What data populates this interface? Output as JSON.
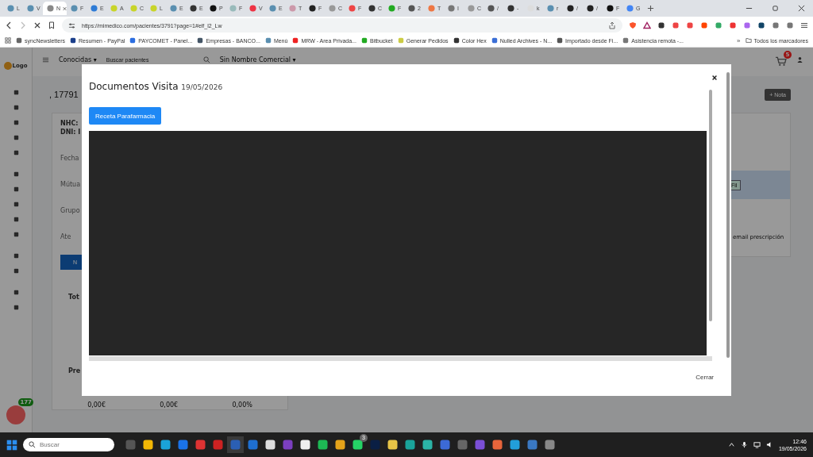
{
  "browser": {
    "tabs": [
      {
        "label": "L",
        "selected": false
      },
      {
        "label": "V",
        "selected": false
      },
      {
        "label": "N",
        "selected": true
      },
      {
        "label": "F",
        "selected": false
      },
      {
        "label": "E",
        "selected": false
      },
      {
        "label": "A",
        "selected": false
      },
      {
        "label": "C",
        "selected": false
      },
      {
        "label": "L",
        "selected": false
      },
      {
        "label": "E",
        "selected": false
      },
      {
        "label": "E",
        "selected": false
      },
      {
        "label": "P",
        "selected": false
      },
      {
        "label": "F",
        "selected": false
      },
      {
        "label": "V",
        "selected": false
      },
      {
        "label": "E",
        "selected": false
      },
      {
        "label": "T",
        "selected": false
      },
      {
        "label": "F",
        "selected": false
      },
      {
        "label": "C",
        "selected": false
      },
      {
        "label": "F",
        "selected": false
      },
      {
        "label": "C",
        "selected": false
      },
      {
        "label": "F",
        "selected": false
      },
      {
        "label": "2",
        "selected": false
      },
      {
        "label": "T",
        "selected": false
      },
      {
        "label": "I",
        "selected": false
      },
      {
        "label": "C",
        "selected": false
      },
      {
        "label": "/",
        "selected": false
      },
      {
        "label": "-",
        "selected": false
      },
      {
        "label": "k",
        "selected": false
      },
      {
        "label": "r",
        "selected": false
      },
      {
        "label": "/",
        "selected": false
      },
      {
        "label": "/",
        "selected": false
      },
      {
        "label": "F",
        "selected": false
      },
      {
        "label": "G",
        "selected": false
      }
    ],
    "url": "https://mimedico.com/pacientes/3791?page=1#elf_l2_Lw",
    "bookmarks": [
      {
        "label": "syncNewsletters"
      },
      {
        "label": "Resumen - PayPal"
      },
      {
        "label": "PAYCOMET - Panel..."
      },
      {
        "label": "Empresas - BANCO..."
      },
      {
        "label": "Menú"
      },
      {
        "label": "MRW - Area Privada..."
      },
      {
        "label": "Bitbucket"
      },
      {
        "label": "Generar Pedidos"
      },
      {
        "label": "Color Hex"
      },
      {
        "label": "Nulled Archives - N..."
      },
      {
        "label": "Importado desde Fi..."
      },
      {
        "label": "Asistencia remota -..."
      }
    ],
    "more_bookmarks": "»",
    "all_bookmarks": "Todos los marcadores"
  },
  "page": {
    "logo": "Logo",
    "nav": {
      "menu": "Conocidas ▾",
      "search_placeholder": "Buscar pacientes",
      "company": "Sin Nombre Comercial ▾"
    },
    "cart_badge": "5",
    "patient_title": ", 17791",
    "info_lines": [
      "NHC:",
      "DNI: I"
    ],
    "fields": [
      "Fecha",
      "Mútua",
      "Grupo"
    ],
    "attending": "Ate",
    "edit_button": "N",
    "totals_label": "Tot",
    "price_label": "Pre",
    "summary_values": [
      "0,00€",
      "0,00€",
      "0,00%"
    ],
    "note_button": "+ Nota",
    "filter_button": "Fil",
    "email_link": "email prescripción",
    "chat_badge": "177"
  },
  "modal": {
    "title": "Documentos Visita",
    "date": "19/05/2026",
    "action_button": "Receta Parafarmacia",
    "footer_button": "Cerrar"
  },
  "taskbar": {
    "search_placeholder": "Buscar",
    "whatsapp_badge": "3",
    "time": "12:46",
    "date": "19/05/2026"
  }
}
